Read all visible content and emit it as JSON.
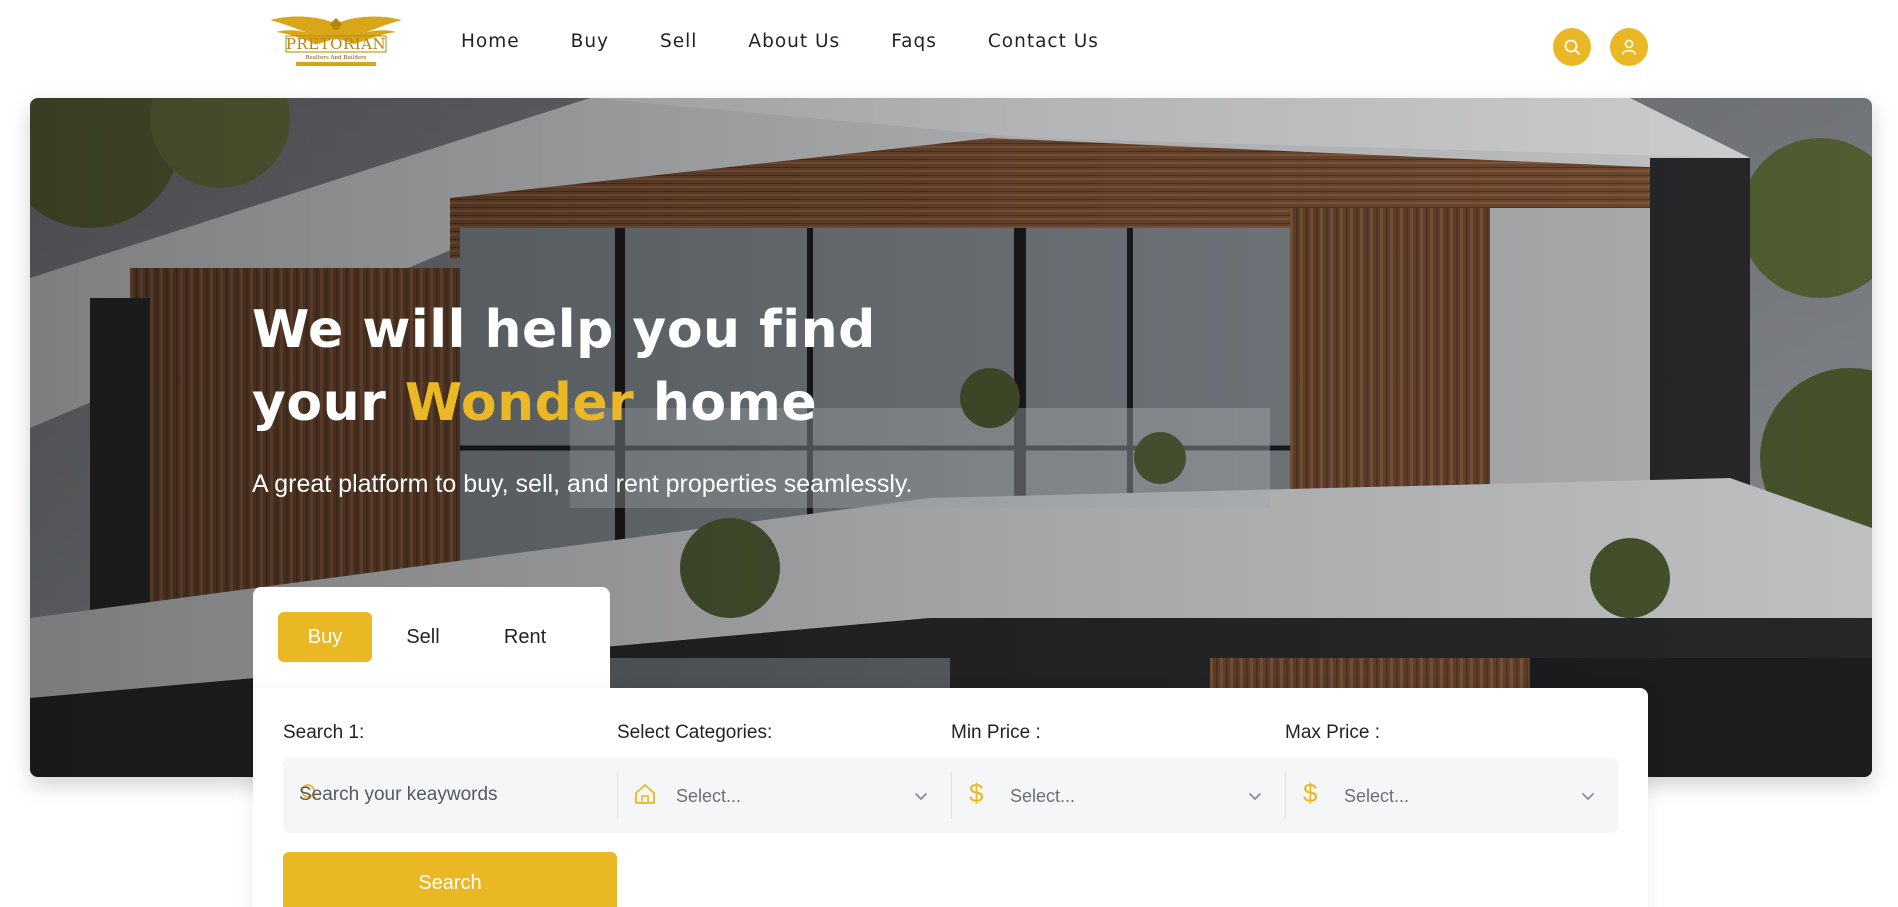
{
  "brand": {
    "logo_text": "PRETORIAN",
    "logo_tagline": "Realtors And Builders"
  },
  "nav": {
    "items": [
      {
        "label": "Home"
      },
      {
        "label": "Buy"
      },
      {
        "label": "Sell"
      },
      {
        "label": "About Us"
      },
      {
        "label": "Faqs"
      },
      {
        "label": "Contact Us"
      }
    ]
  },
  "header_icons": {
    "search": "search-icon",
    "user": "user-icon"
  },
  "hero": {
    "title_line1": "We will help you find",
    "title_prefix": "your",
    "title_accent": "Wonder",
    "title_suffix": "home",
    "subtitle": "A great platform to buy, sell, and rent properties seamlessly."
  },
  "search": {
    "tabs": [
      {
        "label": "Buy",
        "active": true
      },
      {
        "label": "Sell",
        "active": false
      },
      {
        "label": "Rent",
        "active": false
      }
    ],
    "labels": {
      "keyword": "Search 1:",
      "categories": "Select Categories:",
      "min_price": "Min Price :",
      "max_price": "Max Price :"
    },
    "keyword_placeholder": "Search your keaywords",
    "categories_value": "Select...",
    "min_price_value": "Select...",
    "max_price_value": "Select...",
    "button_label": "Search"
  },
  "colors": {
    "accent": "#e9b824",
    "text": "#1f2328",
    "field_bg": "#f5f6f8"
  }
}
